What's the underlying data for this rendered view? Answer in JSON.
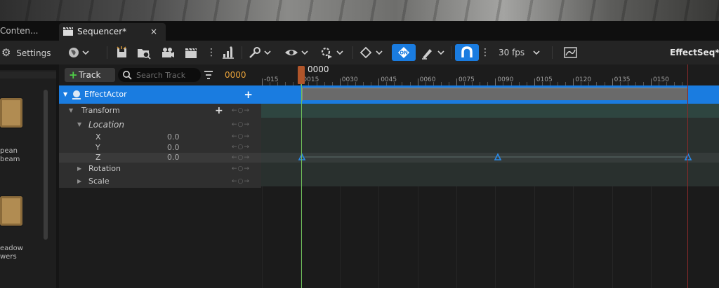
{
  "tabs": {
    "content_browser": "Conten...",
    "sequencer": "Sequencer*",
    "close": "×"
  },
  "toolbar": {
    "settings_label": "Settings",
    "fps_label": "30 fps",
    "sequence_name": "EffectSeq*"
  },
  "left_panel": {
    "items": [
      {
        "label_line1": "pean",
        "label_line2": "beam"
      },
      {
        "label_line1": "eadow",
        "label_line2": "wers"
      }
    ]
  },
  "tree": {
    "add_track_label": "Track",
    "search_placeholder": "Search Track",
    "current_frame": "0000",
    "actor_label": "EffectActor",
    "transform_label": "Transform",
    "location_label": "Location",
    "rotation_label": "Rotation",
    "scale_label": "Scale",
    "x_label": "X",
    "y_label": "Y",
    "z_label": "Z",
    "x_value": "0.0",
    "y_value": "0.0",
    "z_value": "0.0",
    "key_nav": "←○→"
  },
  "timeline": {
    "playhead_label": "0000",
    "ruler_labels": [
      "-015",
      "0015",
      "0030",
      "0045",
      "0060",
      "0075",
      "0090",
      "0105",
      "0120",
      "0135",
      "0150"
    ]
  },
  "colors": {
    "accent": "#1a7ce0",
    "playhead": "#b0552a",
    "frame_text": "#e8a23a",
    "add_green": "#4fcf48"
  }
}
